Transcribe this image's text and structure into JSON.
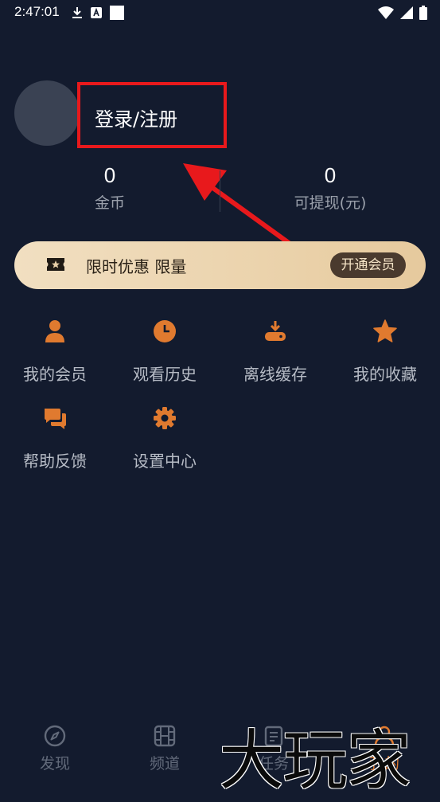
{
  "status_bar": {
    "time": "2:47:01",
    "left_icons": [
      "download-icon",
      "a-icon",
      "square-icon"
    ],
    "right_icons": [
      "wifi-icon",
      "signal-icon",
      "battery-icon"
    ]
  },
  "profile": {
    "login_text": "登录/注册",
    "stats": [
      {
        "value": "0",
        "label": "金币"
      },
      {
        "value": "0",
        "label": "可提现(元)"
      }
    ]
  },
  "vip_banner": {
    "text": "限时优惠 限量",
    "button_label": "开通会员"
  },
  "grid_menu": [
    {
      "label": "我的会员",
      "icon": "user-icon"
    },
    {
      "label": "观看历史",
      "icon": "clock-icon"
    },
    {
      "label": "离线缓存",
      "icon": "download-cache-icon"
    },
    {
      "label": "我的收藏",
      "icon": "star-icon"
    },
    {
      "label": "帮助反馈",
      "icon": "chat-icon"
    },
    {
      "label": "设置中心",
      "icon": "gear-icon"
    }
  ],
  "tabs": [
    {
      "label": "发现",
      "icon": "compass-icon",
      "active": false
    },
    {
      "label": "频道",
      "icon": "film-icon",
      "active": false
    },
    {
      "label": "任务",
      "icon": "task-icon",
      "active": false
    },
    {
      "label": "我的",
      "icon": "profile-icon",
      "active": true
    }
  ],
  "watermark": "大玩家",
  "colors": {
    "background": "#131b2e",
    "accent": "#e07a2f",
    "annotation_red": "#e8191c",
    "banner_gold": "#ead1a9"
  }
}
